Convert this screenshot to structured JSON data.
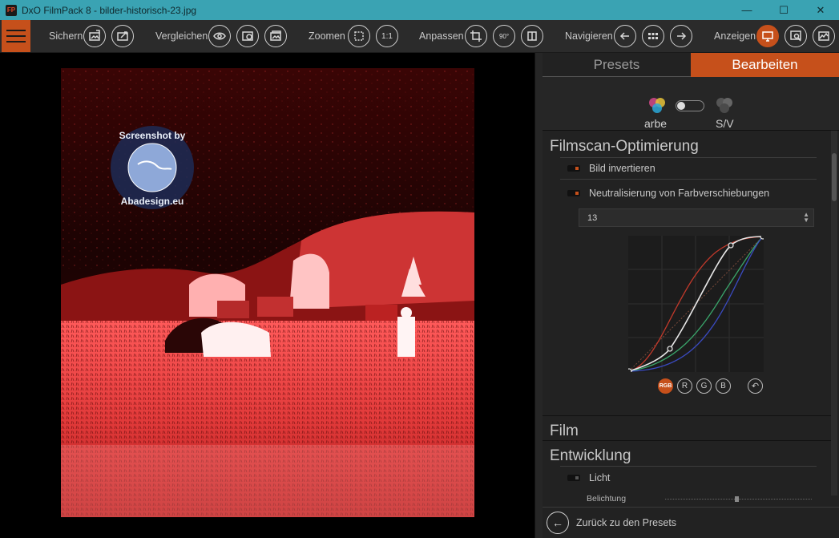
{
  "window": {
    "app_icon": "FP",
    "title": "DxO FilmPack 8 - bilder-historisch-23.jpg",
    "minimize_icon": "minimize-icon",
    "maximize_icon": "maximize-icon",
    "close_icon": "close-icon"
  },
  "toolbar": {
    "save_label": "Sichern",
    "compare_label": "Vergleichen",
    "zoom_label": "Zoomen",
    "zoom_1to1": "1:1",
    "adjust_label": "Anpassen",
    "rotate_label": "90°",
    "navigate_label": "Navigieren",
    "display_label": "Anzeigen"
  },
  "photo": {
    "watermark_top": "Screenshot by",
    "watermark_bottom": "Abadesign.eu"
  },
  "panel": {
    "tabs": [
      "Presets",
      "Bearbeiten"
    ],
    "active_tab": "Bearbeiten",
    "mode_color_label": "arbe",
    "mode_bw_label": "S/V",
    "sections": {
      "filmscan": {
        "title": "Filmscan-Optimierung",
        "invert_label": "Bild invertieren",
        "neutralize_label": "Neutralisierung von Farbverschiebungen",
        "select_value": "13",
        "channels": [
          "RGB",
          "R",
          "G",
          "B"
        ],
        "active_channel": "RGB"
      },
      "film": {
        "title": "Film"
      },
      "development": {
        "title": "Entwicklung",
        "light_label": "Licht",
        "exposure_label": "Belichtung"
      }
    },
    "back_label": "Zurück zu den Presets"
  },
  "colors": {
    "accent": "#c6501b",
    "titlebar": "#3aa3b3",
    "panel_bg": "#222222"
  }
}
